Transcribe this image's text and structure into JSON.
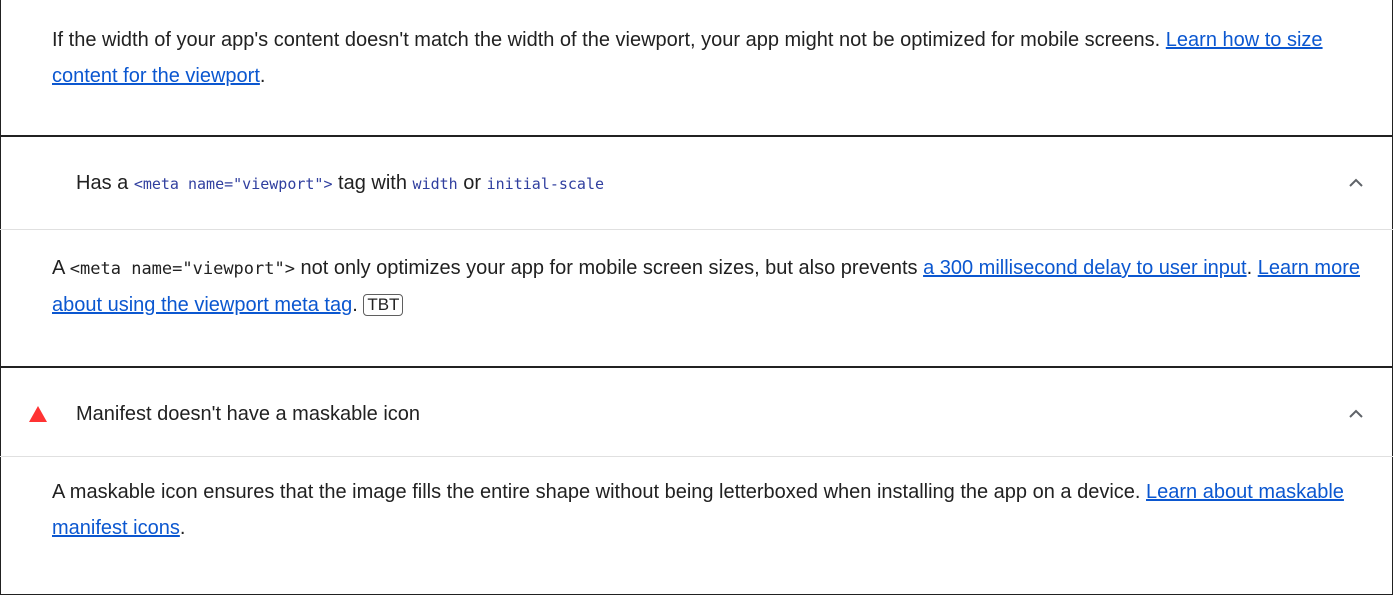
{
  "section1": {
    "desc_text": "If the width of your app's content doesn't match the width of the viewport, your app might not be optimized for mobile screens. ",
    "link": "Learn how to size content for the viewport",
    "after": "."
  },
  "audit_viewport": {
    "title_prefix": "Has a ",
    "code1": "<meta name=\"viewport\">",
    "title_mid": " tag with ",
    "code2": "width",
    "title_or": " or ",
    "code3": "initial-scale",
    "chevron_icon": "chevron-up-icon",
    "desc_prefix": "A ",
    "desc_code": "<meta name=\"viewport\">",
    "desc_text": " not only optimizes your app for mobile screen sizes, but also prevents ",
    "link1": "a 300 millisecond delay to user input",
    "sep": ". ",
    "link2": "Learn more about using the viewport meta tag",
    "after": ". ",
    "badge": "TBT"
  },
  "audit_maskable": {
    "status_icon": "warning-triangle-icon",
    "status_color": "#f33",
    "title": "Manifest doesn't have a maskable icon",
    "chevron_icon": "chevron-up-icon",
    "desc_text": "A maskable icon ensures that the image fills the entire shape without being letterboxed when installing the app on a device. ",
    "link": "Learn about maskable manifest icons",
    "after": "."
  }
}
